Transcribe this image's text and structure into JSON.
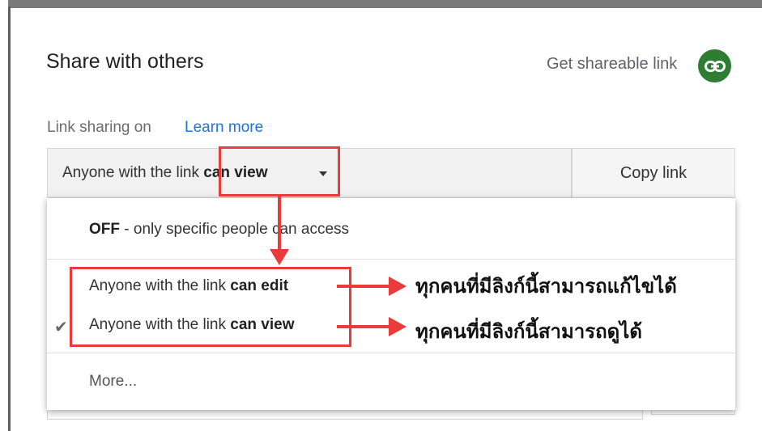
{
  "dialog": {
    "title": "Share with others",
    "get_link_label": "Get shareable link",
    "link_sharing_status": "Link sharing on",
    "learn_more": "Learn more",
    "access": {
      "prefix": "Anyone with the link",
      "level": "can view"
    },
    "copy_link": "Copy link"
  },
  "menu": {
    "off": {
      "bold": "OFF",
      "rest": "- only specific people can access"
    },
    "edit": {
      "prefix": "Anyone with the link",
      "level": "can edit"
    },
    "view": {
      "prefix": "Anyone with the link",
      "level": "can view",
      "selected": true
    },
    "more": "More..."
  },
  "annotations": {
    "edit_note": "ทุกคนที่มีลิงก์นี้สามารถแก้ไขได้",
    "view_note": "ทุกคนที่มีลิงก์นี้สามารถดูได้"
  },
  "colors": {
    "link_icon_bg": "#2e7d32",
    "accent": "#1a73e8",
    "annotation_red": "#ea3b3b"
  }
}
